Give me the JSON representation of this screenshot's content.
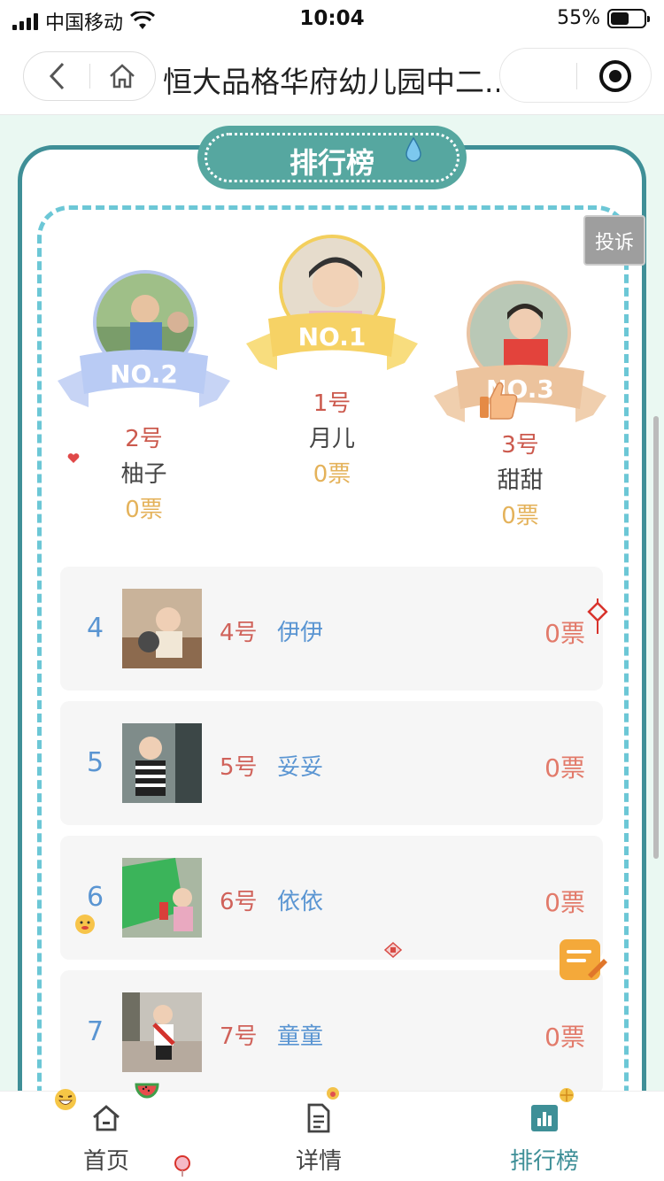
{
  "status_bar": {
    "carrier": "中国移动",
    "time": "10:04",
    "battery_percent": "55%"
  },
  "nav": {
    "title": "恒大品格华府幼儿园中二..."
  },
  "badge_title": "排行榜",
  "complain_label": "投诉",
  "podium": [
    {
      "rank_label": "NO.2",
      "number": "2号",
      "name": "柚子",
      "votes": "0票"
    },
    {
      "rank_label": "NO.1",
      "number": "1号",
      "name": "月儿",
      "votes": "0票"
    },
    {
      "rank_label": "NO.3",
      "number": "3号",
      "name": "甜甜",
      "votes": "0票"
    }
  ],
  "ranking": [
    {
      "rank": "4",
      "number": "4号",
      "name": "伊伊",
      "votes": "0票"
    },
    {
      "rank": "5",
      "number": "5号",
      "name": "妥妥",
      "votes": "0票"
    },
    {
      "rank": "6",
      "number": "6号",
      "name": "依依",
      "votes": "0票"
    },
    {
      "rank": "7",
      "number": "7号",
      "name": "童童",
      "votes": "0票"
    }
  ],
  "tabs": [
    {
      "label": "首页",
      "icon": "home-icon"
    },
    {
      "label": "详情",
      "icon": "document-icon"
    },
    {
      "label": "排行榜",
      "icon": "bar-chart-icon",
      "active": true
    }
  ],
  "colors": {
    "accent": "#3e8f97",
    "badge": "#56a7a0",
    "dash": "#6cc7d6",
    "rank_blue": "#5a95d2",
    "number_red": "#d0625a",
    "vote_gold": "#e4b25a"
  }
}
